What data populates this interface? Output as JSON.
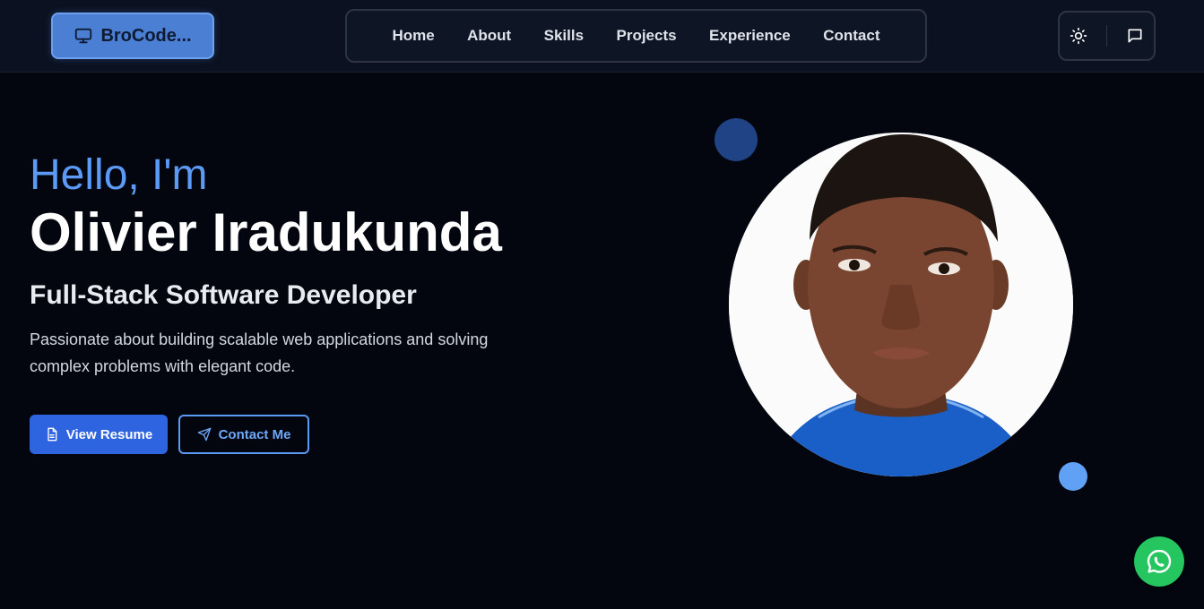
{
  "header": {
    "logo_label": "BroCode...",
    "logo_icon": "monitor-icon",
    "nav": [
      {
        "label": "Home"
      },
      {
        "label": "About"
      },
      {
        "label": "Skills"
      },
      {
        "label": "Projects"
      },
      {
        "label": "Experience"
      },
      {
        "label": "Contact"
      }
    ],
    "actions": {
      "theme_icon": "sun-icon",
      "chat_icon": "message-square-icon"
    }
  },
  "hero": {
    "greeting": "Hello, I'm",
    "name": "Olivier Iradukunda",
    "role": "Full-Stack Software Developer",
    "tagline": "Passionate about building scalable web applications and solving complex problems with elegant code.",
    "resume_button": "View Resume",
    "contact_button": "Contact Me"
  },
  "floating": {
    "whatsapp_icon": "whatsapp-icon"
  },
  "colors": {
    "background": "#03060f",
    "header_bg": "#0b1120",
    "accent": "#2f64e0",
    "accent_light": "#5b9af5",
    "whatsapp": "#25c560"
  }
}
